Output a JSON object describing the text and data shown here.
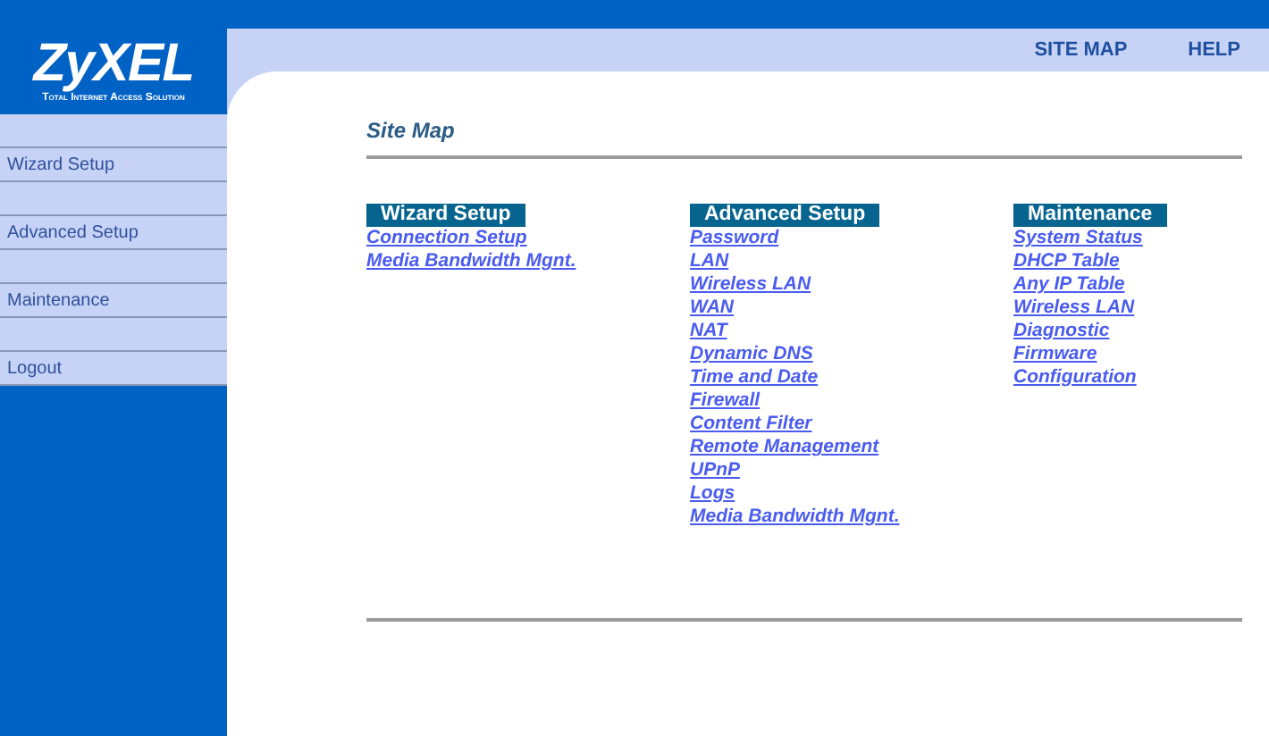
{
  "logo": {
    "name": "ZyXEL",
    "tagline": "Total Internet Access Solution"
  },
  "top_links": [
    "SITE MAP",
    "HELP"
  ],
  "sidebar": {
    "items": [
      "Wizard Setup",
      "Advanced Setup",
      "Maintenance",
      "Logout"
    ]
  },
  "page_title": "Site Map",
  "sections": [
    {
      "title": "Wizard Setup",
      "links": [
        "Connection Setup",
        "Media Bandwidth Mgnt."
      ]
    },
    {
      "title": "Advanced Setup",
      "links": [
        "Password",
        "LAN",
        "Wireless LAN",
        "WAN",
        "NAT",
        "Dynamic DNS",
        "Time and Date",
        "Firewall",
        "Content Filter",
        "Remote Management",
        "UPnP",
        "Logs",
        "Media Bandwidth Mgnt."
      ]
    },
    {
      "title": "Maintenance",
      "links": [
        "System Status",
        "DHCP Table",
        "Any IP Table",
        "Wireless LAN",
        "Diagnostic",
        "Firmware",
        "Configuration"
      ]
    }
  ]
}
